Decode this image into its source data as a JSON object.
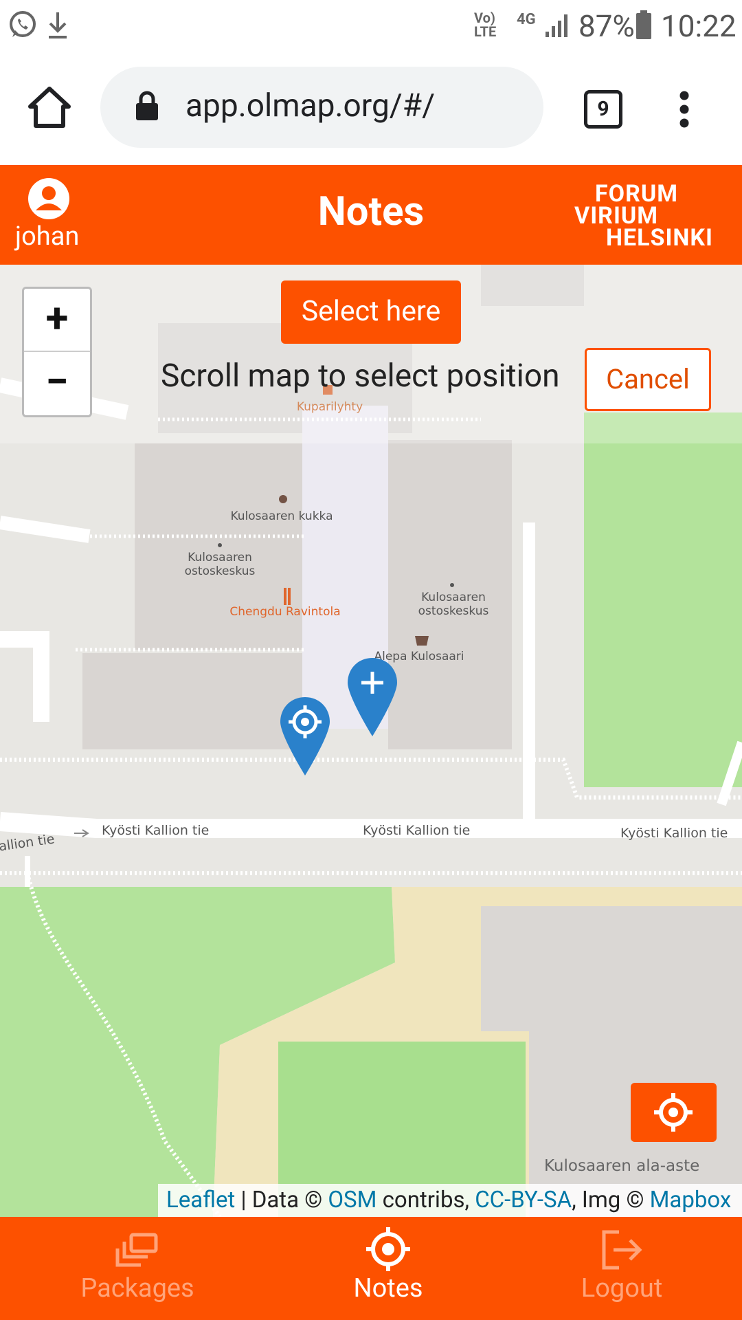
{
  "status_bar": {
    "network_label": "Vo) LTE",
    "network_type": "4G",
    "battery": "87%",
    "time": "10:22"
  },
  "browser": {
    "url": "app.olmap.org/#/",
    "tab_count": "9"
  },
  "header": {
    "username": "johan",
    "title": "Notes",
    "brand_lines": [
      "FORUM",
      "VIRIUM",
      "HELSINKI"
    ]
  },
  "map": {
    "zoom_in_label": "+",
    "zoom_out_label": "−",
    "select_button_label": "Select here",
    "hint_text": "Scroll map to select position",
    "cancel_button_label": "Cancel",
    "labels": {
      "kuparilyhty": "Kuparilyhty",
      "kukka": "Kulosaaren kukka",
      "ostoskeskus_a_line1": "Kulosaaren",
      "ostoskeskus_a_line2": "ostoskeskus",
      "chengdu": "Chengdu Ravintola",
      "ostoskeskus_b_line1": "Kulosaaren",
      "ostoskeskus_b_line2": "ostoskeskus",
      "alepa": "Alepa Kulosaari",
      "road_1": "Kyösti Kallion tie",
      "road_2": "Kyösti Kallion tie",
      "road_3": "Kyösti Kallion tie",
      "road_partial": "allion tie",
      "school": "Kulosaaren ala-aste"
    },
    "attribution": {
      "leaflet": "Leaflet",
      "sep1": " | Data © ",
      "osm": "OSM",
      "contribs": " contribs, ",
      "license": "CC-BY-SA",
      "img": ", Img © ",
      "mapbox": "Mapbox"
    }
  },
  "bottom_nav": {
    "items": [
      {
        "label": "Packages",
        "active": false
      },
      {
        "label": "Notes",
        "active": true
      },
      {
        "label": "Logout",
        "active": false
      }
    ]
  },
  "colors": {
    "brand_orange": "#fd5100",
    "marker_blue": "#2a81cb",
    "park_green": "#b3e39b",
    "sand": "#f0e5bd"
  }
}
